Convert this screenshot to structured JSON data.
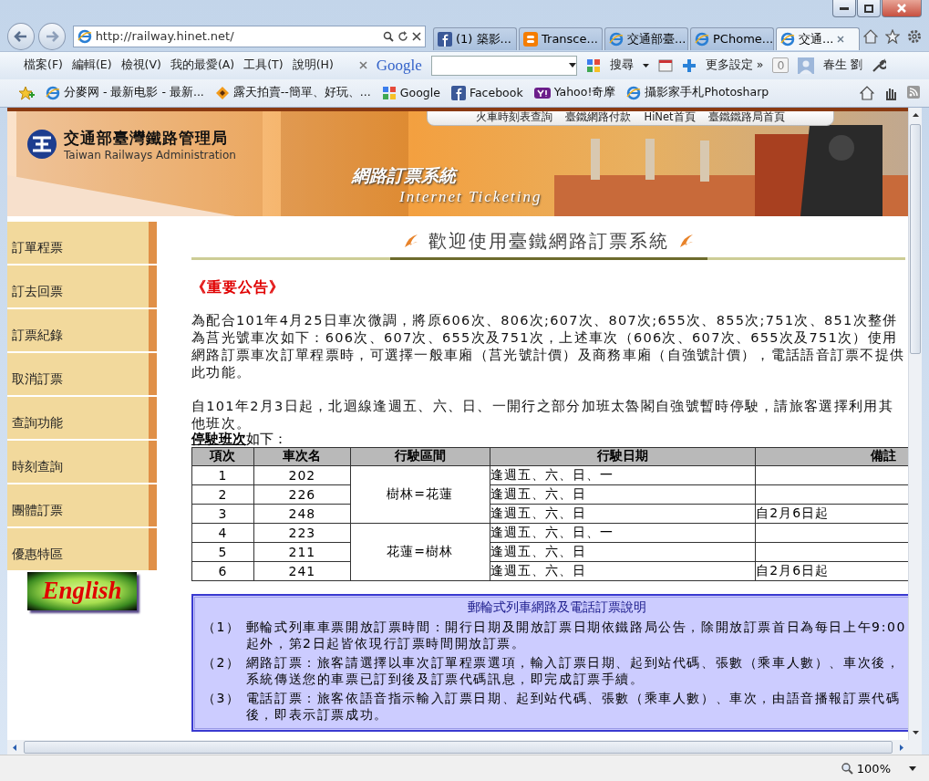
{
  "browser": {
    "address": "http://railway.hinet.net/",
    "tabs": [
      {
        "label": "(1) 築影...",
        "selected": false,
        "kind": "facebook"
      },
      {
        "label": "Transce...",
        "selected": false,
        "kind": "blogger"
      },
      {
        "label": "交通部臺...",
        "selected": false,
        "kind": "ie"
      },
      {
        "label": "PChome...",
        "selected": false,
        "kind": "ie"
      },
      {
        "label": "交通...",
        "selected": true,
        "kind": "ie"
      }
    ],
    "menu": [
      "檔案(F)",
      "編輯(E)",
      "檢視(V)",
      "我的最愛(A)",
      "工具(T)",
      "說明(H)"
    ],
    "google_toolbar": {
      "logo": "Google",
      "search_label": "搜尋",
      "more": "更多設定 »",
      "count": "0",
      "user": "春生 劉"
    },
    "favorites": [
      {
        "label": "分麥网 - 最新电影 - 最新...",
        "kind": "ie"
      },
      {
        "label": "露天拍賣--簡單、好玩、...",
        "kind": "ruten"
      },
      {
        "label": "Google",
        "kind": "google"
      },
      {
        "label": "Facebook",
        "kind": "facebook"
      },
      {
        "label": "Yahoo!奇摩",
        "kind": "yahoo"
      },
      {
        "label": "攝影家手札Photosharp",
        "kind": "ie"
      }
    ],
    "zoom": "100%"
  },
  "page": {
    "top_links": [
      "火車時刻表查詢",
      "臺鐵網路付款",
      "HiNet首頁",
      "臺鐵鐵路局首頁"
    ],
    "logo": {
      "name": "交通部臺灣鐵路管理局",
      "english": "Taiwan Railways Administration"
    },
    "system": {
      "title": "網路訂票系統",
      "subtitle": "Internet Ticketing"
    },
    "sidebar": {
      "items": [
        "訂單程票",
        "訂去回票",
        "訂票紀錄",
        "取消訂票",
        "查詢功能",
        "時刻查詢",
        "團體訂票",
        "優惠特區"
      ],
      "english_button": "English"
    },
    "heading": "歡迎使用臺鐵網路訂票系統",
    "notice_title": "《重要公告》",
    "paragraphs": [
      "為配合101年4月25日車次微調，將原606次、806次;607次、807次;655次、855次;751次、851次整併為莒光號車次如下：606次、607次、655次及751次，上述車次（606次、607次、655次及751次）使用網路訂票車次訂單程票時，可選擇一般車廂（莒光號計價）及商務車廂（自強號計價），電話語音訂票不提供此功能。",
      "自101年2月3日起，北迴線逢週五、六、日、一開行之部分加班太魯閣自強號暫時停駛，請旅客選擇利用其他班次。"
    ],
    "table_caption": "**停駛班次**如下：",
    "table": {
      "columns": [
        "項次",
        "車次名",
        "行駛區間",
        "行駛日期",
        "備註"
      ],
      "groups": [
        {
          "route": "樹林=花蓮",
          "rows": [
            {
              "no": "1",
              "train": "202",
              "days": "逢週五、六、日、一"
            },
            {
              "no": "2",
              "train": "226",
              "days": "逢週五、六、日"
            },
            {
              "no": "3",
              "train": "248",
              "days": "逢週五、六、日",
              "note": "自2月6日起"
            }
          ]
        },
        {
          "route": "花蓮=樹林",
          "rows": [
            {
              "no": "4",
              "train": "223",
              "days": "逢週五、六、日、一"
            },
            {
              "no": "5",
              "train": "211",
              "days": "逢週五、六、日"
            },
            {
              "no": "6",
              "train": "241",
              "days": "逢週五、六、日",
              "note": "自2月6日起"
            }
          ]
        }
      ]
    },
    "info_box": {
      "title": "郵輪式列車網路及電話訂票說明",
      "items": [
        {
          "marker": "（1）",
          "text": "郵輪式列車車票開放訂票時間：開行日期及開放訂票日期依鐵路局公告，除開放訂票首日為每日上午9:00起外，第2日起皆依現行訂票時間開放訂票。"
        },
        {
          "marker": "（2）",
          "text": "網路訂票：旅客請選擇以車次訂單程票選項，輸入訂票日期、起到站代碼、張數（乘車人數）、車次後，系統傳送您的車票已訂到後及訂票代碼訊息，即完成訂票手續。"
        },
        {
          "marker": "（3）",
          "text": "電話訂票：旅客依語音指示輸入訂票日期、起到站代碼、張數（乘車人數）、車次，由語音播報訂票代碼後，即表示訂票成功。"
        }
      ]
    }
  }
}
